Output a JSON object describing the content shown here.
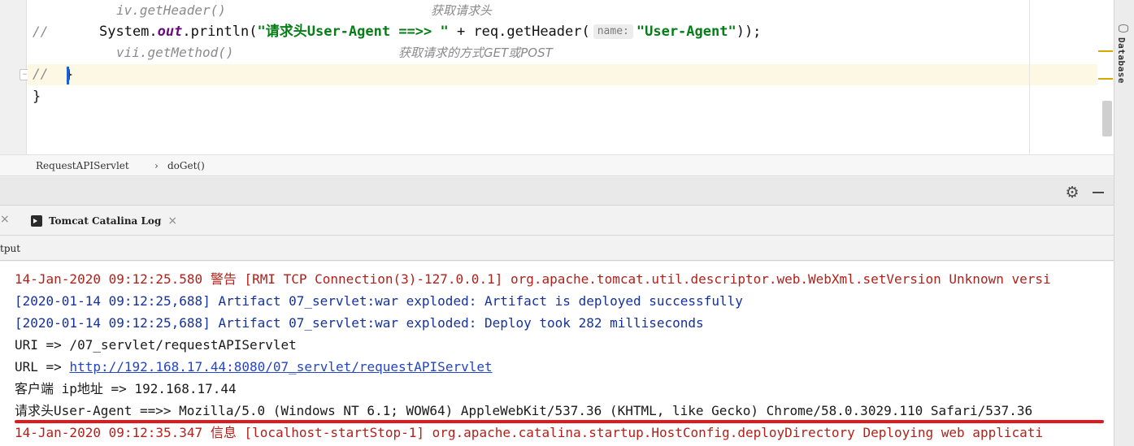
{
  "editor": {
    "comment_slash": "//",
    "line1_code": "iv.getHeader()",
    "line1_note": "获取请求头",
    "line2_prefix": "System.",
    "line2_field": "out",
    "line2_mid": ".println(",
    "line2_string": "\"请求头User-Agent ==>> \"",
    "line2_mid2": " + req.getHeader(",
    "line2_hint": "name:",
    "line2_arg": "\"User-Agent\"",
    "line2_suffix": "));",
    "line3_code": "vii.getMethod()",
    "line3_note": "获取请求的方式GET或POST",
    "brace_method": "}",
    "brace_class": "}"
  },
  "breadcrumb": {
    "class_name": "RequestAPIServlet",
    "separator": "›",
    "method": "doGet()"
  },
  "tool_window": {
    "side_label": "Database",
    "tab_label": "Tomcat Catalina Log",
    "output_label": "tput",
    "gear_icon": "gear-icon",
    "close_glyph": "×"
  },
  "console": {
    "lines": [
      "14-Jan-2020 09:12:25.580 警告 [RMI TCP Connection(3)-127.0.0.1] org.apache.tomcat.util.descriptor.web.WebXml.setVersion Unknown versi",
      "[2020-01-14 09:12:25,688] Artifact 07_servlet:war exploded: Artifact is deployed successfully",
      "[2020-01-14 09:12:25,688] Artifact 07_servlet:war exploded: Deploy took 282 milliseconds",
      "URI => /07_servlet/requestAPIServlet",
      "URL => ",
      "客户端 ip地址 => 192.168.17.44",
      "请求头User-Agent ==>> Mozilla/5.0 (Windows NT 6.1; WOW64) AppleWebKit/537.36 (KHTML, like Gecko) Chrome/58.0.3029.110 Safari/537.36",
      "14-Jan-2020 09:12:35.347 信息 [localhost-startStop-1] org.apache.catalina.startup.HostConfig.deployDirectory Deploying web applicati"
    ],
    "url_link": "http://192.168.17.44:8080/07_servlet/requestAPIServlet"
  },
  "colors": {
    "log_red": "#b2201a",
    "log_blue": "#15329c",
    "highlight_underline": "#e0191f",
    "string_green": "#067d17"
  }
}
